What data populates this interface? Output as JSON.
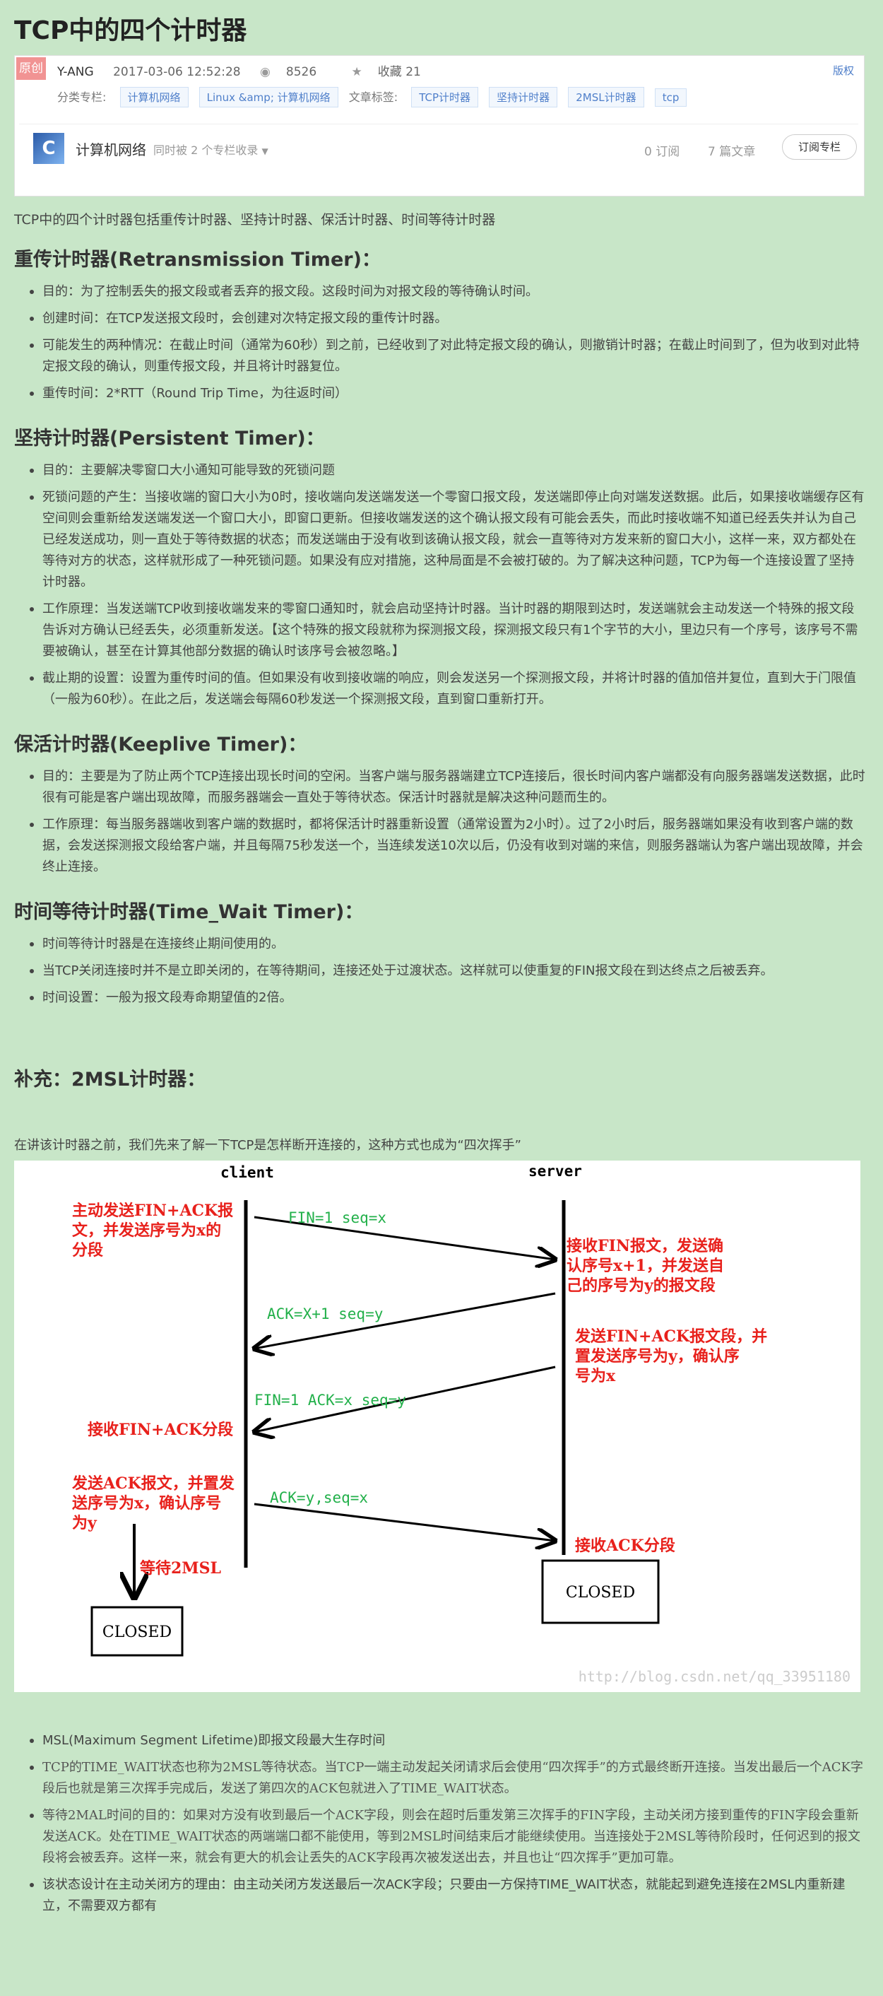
{
  "title": "TCP中的四个计时器",
  "meta": {
    "original_badge": "原创",
    "author": "Y-ANG",
    "date": "2017-03-06 12:52:28",
    "views": "8526",
    "favorites": "收藏 21",
    "copyright": "版权",
    "column_label": "分类专栏:",
    "column_tags": [
      "计算机网络",
      "Linux &amp; 计算机网络"
    ],
    "article_tag_label": "文章标签:",
    "article_tags": [
      "TCP计时器",
      "坚持计时器",
      "2MSL计时器",
      "tcp"
    ]
  },
  "column": {
    "logo_letter": "C",
    "name": "计算机网络",
    "collected": "同时被 2 个专栏收录",
    "subscriptions": "0 订阅",
    "articles": "7 篇文章",
    "subscribe_btn": "订阅专栏"
  },
  "intro": "TCP中的四个计时器包括重传计时器、坚持计时器、保活计时器、时间等待计时器",
  "sections": [
    {
      "heading": "重传计时器(Retransmission Timer)：",
      "items": [
        "目的：为了控制丢失的报文段或者丢弃的报文段。这段时间为对报文段的等待确认时间。",
        "创建时间：在TCP发送报文段时，会创建对次特定报文段的重传计时器。",
        "可能发生的两种情况：在截止时间（通常为60秒）到之前，已经收到了对此特定报文段的确认，则撤销计时器；在截止时间到了，但为收到对此特定报文段的确认，则重传报文段，并且将计时器复位。",
        "重传时间：2*RTT（Round Trip Time，为往返时间）"
      ]
    },
    {
      "heading": "坚持计时器(Persistent Timer)：",
      "items": [
        "目的：主要解决零窗口大小通知可能导致的死锁问题",
        "死锁问题的产生：当接收端的窗口大小为0时，接收端向发送端发送一个零窗口报文段，发送端即停止向对端发送数据。此后，如果接收端缓存区有空间则会重新给发送端发送一个窗口大小，即窗口更新。但接收端发送的这个确认报文段有可能会丢失，而此时接收端不知道已经丢失并认为自己已经发送成功，则一直处于等待数据的状态；而发送端由于没有收到该确认报文段，就会一直等待对方发来新的窗口大小，这样一来，双方都处在等待对方的状态，这样就形成了一种死锁问题。如果没有应对措施，这种局面是不会被打破的。为了解决这种问题，TCP为每一个连接设置了坚持计时器。",
        "工作原理：当发送端TCP收到接收端发来的零窗口通知时，就会启动坚持计时器。当计时器的期限到达时，发送端就会主动发送一个特殊的报文段告诉对方确认已经丢失，必须重新发送。【这个特殊的报文段就称为探测报文段，探测报文段只有1个字节的大小，里边只有一个序号，该序号不需要被确认，甚至在计算其他部分数据的确认时该序号会被忽略。】",
        "截止期的设置：设置为重传时间的值。但如果没有收到接收端的响应，则会发送另一个探测报文段，并将计时器的值加倍并复位，直到大于门限值（一般为60秒）。在此之后，发送端会每隔60秒发送一个探测报文段，直到窗口重新打开。"
      ]
    },
    {
      "heading": "保活计时器(Keeplive Timer)：",
      "items": [
        "目的：主要是为了防止两个TCP连接出现长时间的空闲。当客户端与服务器端建立TCP连接后，很长时间内客户端都没有向服务器端发送数据，此时很有可能是客户端出现故障，而服务器端会一直处于等待状态。保活计时器就是解决这种问题而生的。",
        "工作原理：每当服务器端收到客户端的数据时，都将保活计时器重新设置（通常设置为2小时）。过了2小时后，服务器端如果没有收到客户端的数据，会发送探测报文段给客户端，并且每隔75秒发送一个，当连续发送10次以后，仍没有收到对端的来信，则服务器端认为客户端出现故障，并会终止连接。"
      ]
    },
    {
      "heading": "时间等待计时器(Time_Wait Timer)：",
      "items": [
        "时间等待计时器是在连接终止期间使用的。",
        "当TCP关闭连接时并不是立即关闭的，在等待期间，连接还处于过渡状态。这样就可以使重复的FIN报文段在到达终点之后被丢弃。",
        "时间设置：一般为报文段寿命期望值的2倍。"
      ]
    }
  ],
  "supplement_heading": "补充：2MSL计时器：",
  "pre_figure": "在讲该计时器之前，我们先来了解一下TCP是怎样断开连接的，这种方式也成为“四次挥手”",
  "figure": {
    "client": "client",
    "server": "server",
    "msg1": "FIN=1 seq=x",
    "msg2": "ACK=X+1 seq=y",
    "msg3": "FIN=1 ACK=x seq=y",
    "msg4": "ACK=y,seq=x",
    "c1": [
      "主动发送FIN+ACK报",
      "文，并发送序号为x的",
      "分段"
    ],
    "s1": [
      "接收FIN报文，发送确",
      "认序号x+1，并发送自",
      "己的序号为y的报文段"
    ],
    "s2": [
      "发送FIN+ACK报文段，并",
      "置发送序号为y，确认序",
      "号为x"
    ],
    "c2": "接收FIN+ACK分段",
    "c3": [
      "发送ACK报文，并置发",
      "送序号为x，确认序号",
      "为y"
    ],
    "wait": "等待2MSL",
    "s3": "接收ACK分段",
    "closed": "CLOSED",
    "watermark": "http://blog.csdn.net/qq_33951180"
  },
  "msl_items": [
    "MSL(Maximum Segment Lifetime)即报文段最大生存时间",
    "TCP的TIME_WAIT状态也称为2MSL等待状态。当TCP一端主动发起关闭请求后会使用“四次挥手”的方式最终断开连接。当发出最后一个ACK字段后也就是第三次挥手完成后，发送了第四次的ACK包就进入了TIME_WAIT状态。",
    "等待2MAL时间的目的：如果对方没有收到最后一个ACK字段，则会在超时后重发第三次挥手的FIN字段，主动关闭方接到重传的FIN字段会重新发送ACK。处在TIME_WAIT状态的两端端口都不能使用，等到2MSL时间结束后才能继续使用。当连接处于2MSL等待阶段时，任何迟到的报文段将会被丢弃。这样一来，就会有更大的机会让丢失的ACK字段再次被发送出去，并且也让“四次挥手”更加可靠。",
    "该状态设计在主动关闭方的理由：由主动关闭方发送最后一次ACK字段；只要由一方保持TIME_WAIT状态，就能起到避免连接在2MSL内重新建立，不需要双方都有"
  ],
  "colors": {
    "bg": "#c8e6c8",
    "fig_red": "#e8211c",
    "fig_green": "#22b04a",
    "tag_blue": "#4f7fca"
  }
}
